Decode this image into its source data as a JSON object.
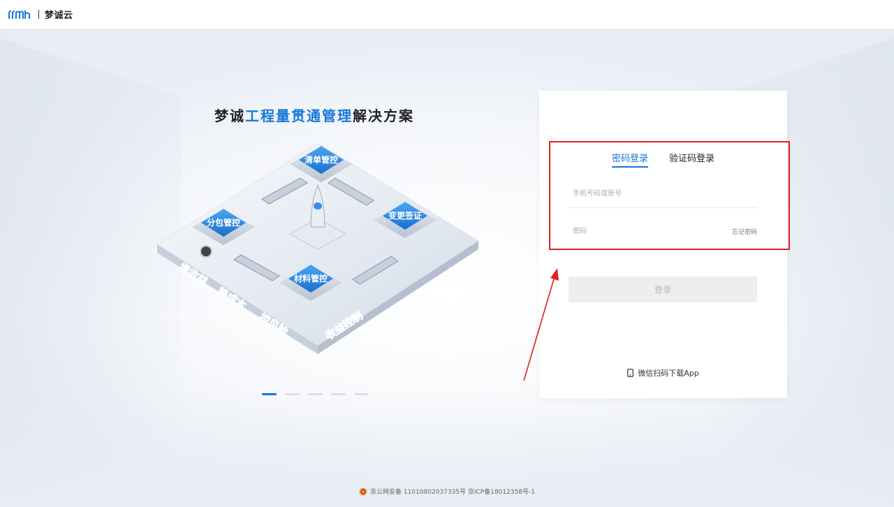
{
  "header": {
    "logo_text": "rrmh",
    "brand": "梦诚云"
  },
  "hero": {
    "title_part1": "梦诚",
    "title_highlight": "工程量贯通管理",
    "title_part2": "解决方案",
    "modules": [
      "清单管控",
      "分包管控",
      "变更签证",
      "材料管控"
    ],
    "slogans": [
      "增收益",
      "降成本",
      "控风险",
      "收益控制"
    ],
    "slides_count": 5,
    "active_slide": 0
  },
  "login": {
    "tabs": [
      {
        "label": "密码登录",
        "active": true
      },
      {
        "label": "验证码登录",
        "active": false
      }
    ],
    "username_placeholder": "手机号码或账号",
    "password_placeholder": "密码",
    "forgot_label": "忘记密码",
    "submit_label": "登录",
    "app_download_label": "微信扫码下载App"
  },
  "footer": {
    "icp_text": "京公网安备 11010802037335号 京ICP备18012358号-1"
  },
  "colors": {
    "accent": "#1677d8",
    "annotation": "#e02020"
  }
}
